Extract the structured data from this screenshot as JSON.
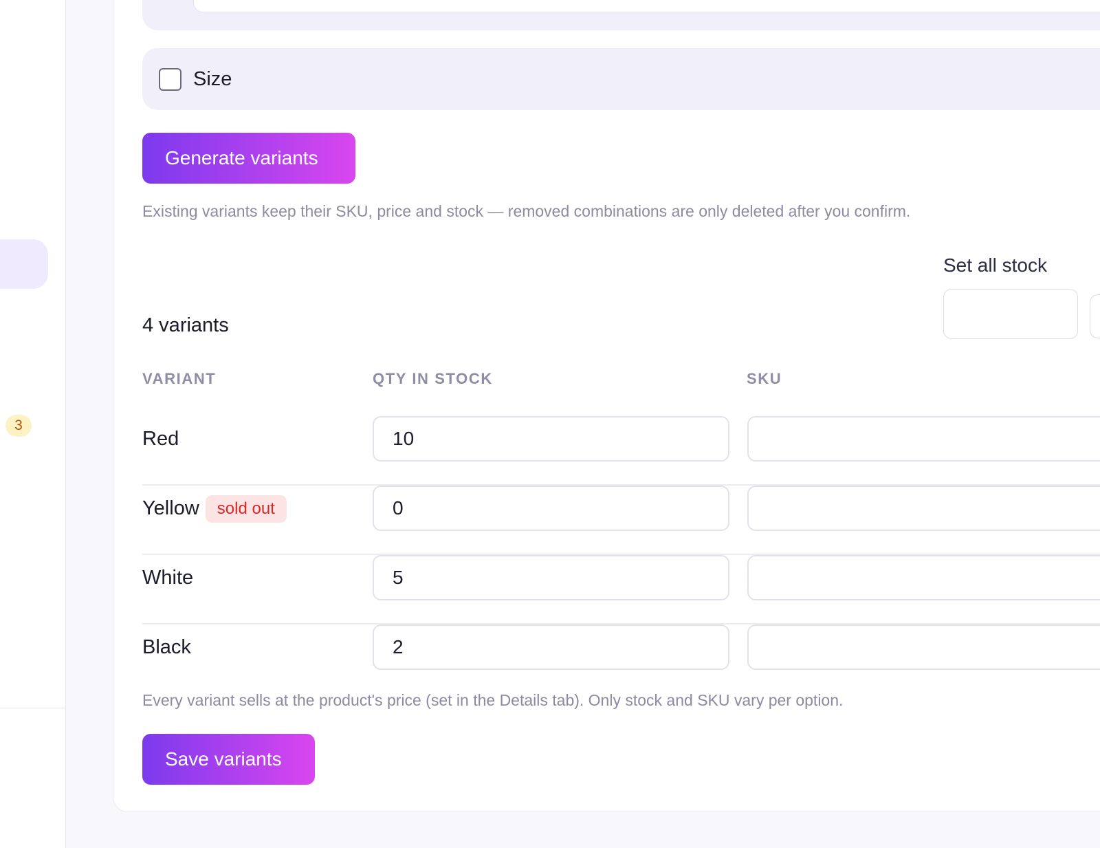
{
  "sidebar": {
    "badge_count": "3"
  },
  "options": {
    "size_label": "Size"
  },
  "actions": {
    "generate_label": "Generate variants",
    "generate_hint": "Existing variants keep their SKU, price and stock — removed combinations are only deleted after you confirm.",
    "save_label": "Save variants",
    "save_hint": "Every variant sells at the product's price (set in the Details tab). Only stock and SKU vary per option."
  },
  "bulk": {
    "set_all_stock_label": "Set all stock",
    "set_all_stock_value": ""
  },
  "variants": {
    "count_label": "4 variants",
    "columns": {
      "variant": "VARIANT",
      "qty": "QTY IN STOCK",
      "sku": "SKU"
    },
    "rows": [
      {
        "name": "Red",
        "qty": "10",
        "sku": "",
        "badge": ""
      },
      {
        "name": "Yellow",
        "qty": "0",
        "sku": "",
        "badge": "sold out"
      },
      {
        "name": "White",
        "qty": "5",
        "sku": "",
        "badge": ""
      },
      {
        "name": "Black",
        "qty": "2",
        "sku": "",
        "badge": ""
      }
    ]
  },
  "colors": {
    "accent_start": "#7c3aed",
    "accent_end": "#d946ef",
    "sold_out_text": "#dc2626",
    "sold_out_bg": "#fde4e4",
    "badge_bg": "#fdf2c4"
  }
}
